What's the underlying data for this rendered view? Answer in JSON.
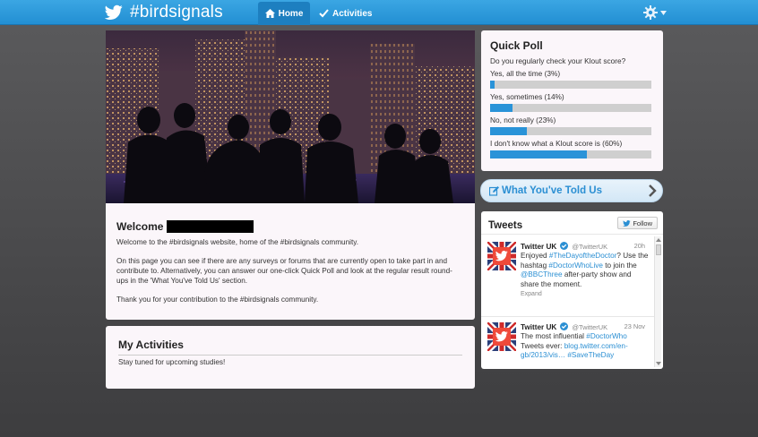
{
  "header": {
    "title": "#birdsignals",
    "nav": [
      {
        "label": "Home"
      },
      {
        "label": "Activities"
      }
    ]
  },
  "welcome": {
    "title": "Welcome",
    "paragraphs": [
      "Welcome to the #birdsignals website, home of the #birdsignals community.",
      "On this page you can see if there are any surveys or forums that are currently open to take part in and contribute to. Alternatively, you can answer our one-click Quick Poll and look at the regular result round-ups in the 'What You've Told Us' section.",
      "Thank you for your contribution to the #birdsignals community."
    ]
  },
  "activities": {
    "title": "My Activities",
    "text": "Stay tuned for upcoming studies!"
  },
  "poll": {
    "title": "Quick Poll",
    "question": "Do you regularly check your Klout score?",
    "options": [
      {
        "label": "Yes, all the time (3%)",
        "percent": 3
      },
      {
        "label": "Yes, sometimes (14%)",
        "percent": 14
      },
      {
        "label": "No, not really (23%)",
        "percent": 23
      },
      {
        "label": "I don't know what a Klout score is (60%)",
        "percent": 60
      }
    ]
  },
  "told": {
    "label": "What You've Told Us"
  },
  "tweets": {
    "title": "Tweets",
    "follow_label": "Follow",
    "items": [
      {
        "name": "Twitter UK",
        "handle": "@TwitterUK",
        "time": "20h",
        "parts": [
          {
            "t": "Enjoyed ",
            "link": false
          },
          {
            "t": "#TheDayoftheDoctor",
            "link": true
          },
          {
            "t": "? Use the hashtag ",
            "link": false
          },
          {
            "t": "#DoctorWhoLive",
            "link": true
          },
          {
            "t": " to join the ",
            "link": false
          },
          {
            "t": "@BBCThree",
            "link": true
          },
          {
            "t": " after-party show and share the moment.",
            "link": false
          }
        ],
        "expand": "Expand"
      },
      {
        "name": "Twitter UK",
        "handle": "@TwitterUK",
        "time": "23 Nov",
        "parts": [
          {
            "t": "The most influential ",
            "link": false
          },
          {
            "t": "#DoctorWho",
            "link": true
          },
          {
            "t": " Tweets ever: ",
            "link": false
          },
          {
            "t": "blog.twitter.com/en-gb/2013/vis…",
            "link": true
          },
          {
            "t": " ",
            "link": false
          },
          {
            "t": "#SaveTheDay",
            "link": true
          }
        ]
      }
    ]
  }
}
